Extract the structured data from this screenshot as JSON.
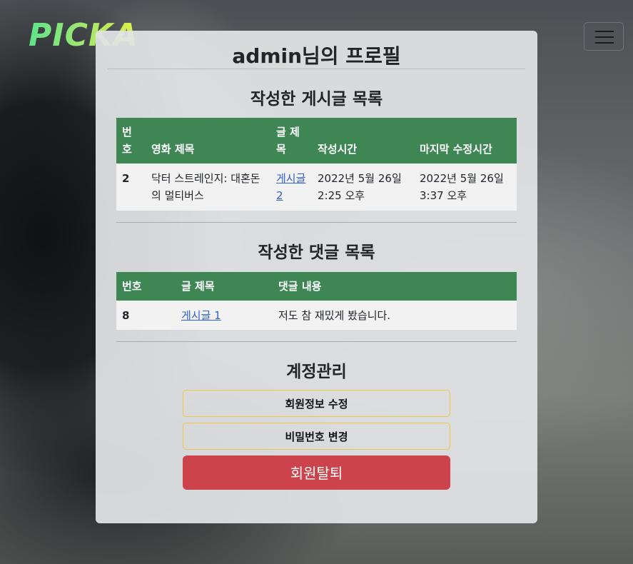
{
  "header": {
    "logo_text": "PICKA",
    "menu_icon": "hamburger-icon"
  },
  "profile": {
    "title": "admin님의 프로필"
  },
  "posts": {
    "title": "작성한 게시글 목록",
    "columns": [
      "번호",
      "영화 제목",
      "글 제목",
      "작성시간",
      "마지막 수정시간"
    ],
    "rows": [
      {
        "number": "2",
        "movie": "닥터 스트레인지: 대혼돈의 멀티버스",
        "post_title": "게시글 2",
        "created": "2022년 5월 26일 2:25 오후",
        "updated": "2022년 5월 26일 3:37 오후"
      }
    ]
  },
  "comments": {
    "title": "작성한 댓글 목록",
    "columns": [
      "번호",
      "글 제목",
      "댓글 내용"
    ],
    "rows": [
      {
        "number": "8",
        "post_title": "게시글 1",
        "content": "저도 참 재밌게 봤습니다."
      }
    ]
  },
  "account": {
    "title": "계정관리",
    "edit_label": "회원정보 수정",
    "password_label": "비밀번호 변경",
    "withdraw_label": "회원탈퇴"
  },
  "colors": {
    "table_header": "#3e8755",
    "danger": "#cd434b",
    "outline": "#f0c64a",
    "link": "#2f62d4"
  }
}
